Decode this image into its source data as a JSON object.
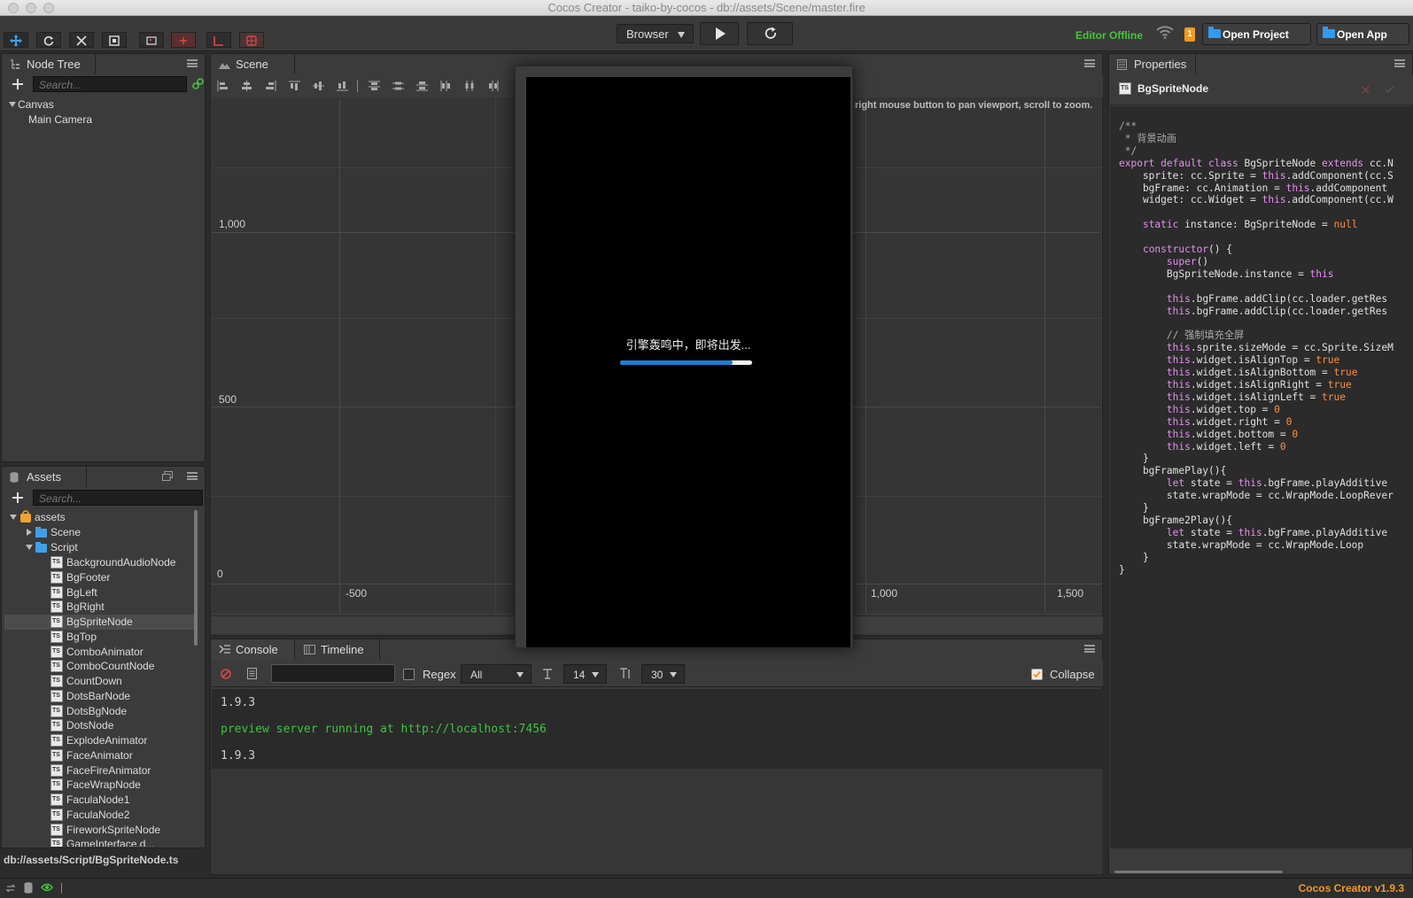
{
  "window": {
    "title": "Cocos Creator - taiko-by-cocos - db://assets/Scene/master.fire"
  },
  "toolbar": {
    "platform_select": "Browser",
    "status": "Editor Offline",
    "notification_count": "1",
    "open_project": "Open Project",
    "open_app": "Open App"
  },
  "node_tree": {
    "tab": "Node Tree",
    "search_placeholder": "Search...",
    "nodes": [
      {
        "label": "Canvas"
      },
      {
        "label": "Main Camera"
      }
    ]
  },
  "assets": {
    "tab": "Assets",
    "search_placeholder": "Search...",
    "root": "assets",
    "folders": [
      "Scene",
      "Script"
    ],
    "scripts": [
      "BackgroundAudioNode",
      "BgFooter",
      "BgLeft",
      "BgRight",
      "BgSpriteNode",
      "BgTop",
      "ComboAnimator",
      "ComboCountNode",
      "CountDown",
      "DotsBarNode",
      "DotsBgNode",
      "DotsNode",
      "ExplodeAnimator",
      "FaceAnimator",
      "FaceFireAnimator",
      "FaceWrapNode",
      "FaculaNode1",
      "FaculaNode2",
      "FireworkSpriteNode",
      "GameInterface.d..."
    ],
    "selected": "BgSpriteNode",
    "status_path": "db://assets/Script/BgSpriteNode.ts"
  },
  "scene": {
    "tab": "Scene",
    "hint": "right mouse button to pan viewport, scroll to zoom.",
    "y_labels": [
      "1,000",
      "500",
      "0"
    ],
    "x_labels": [
      "-500",
      "1,000",
      "1,500"
    ]
  },
  "preview": {
    "loading_text": "引擎轰鸣中，即将出发...",
    "progress": 0.85
  },
  "console": {
    "tabs": [
      "Console",
      "Timeline"
    ],
    "regex_label": "Regex",
    "filter_level": "All",
    "font_size": "14",
    "line_height": "30",
    "collapse_label": "Collapse",
    "logs": [
      {
        "text": "1.9.3",
        "color": "#cfcfcf"
      },
      {
        "text": "preview server running at http://localhost:7456",
        "color": "#3ec33e"
      },
      {
        "text": "1.9.3",
        "color": "#cfcfcf"
      }
    ]
  },
  "properties": {
    "tab": "Properties",
    "component": "BgSpriteNode"
  },
  "footer": {
    "version": "Cocos Creator v1.9.3"
  }
}
